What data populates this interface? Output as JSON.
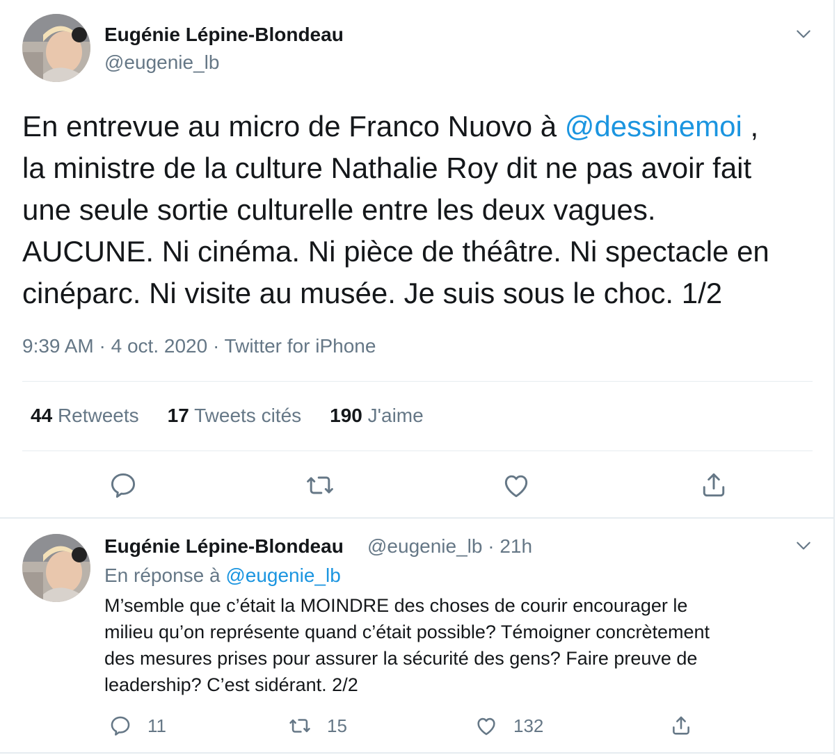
{
  "tweet": {
    "author_name": "Eugénie Lépine-Blondeau",
    "author_handle": "@eugenie_lb",
    "text_lines": [
      "En entrevue au micro de Franco Nuovo à ",
      "la ministre de la culture Nathalie Roy dit ne pas avoir fait",
      "une seule sortie culturelle entre les deux vagues.",
      "AUCUNE. Ni cinéma. Ni pièce de théâtre. Ni spectacle en",
      "cinéparc. Ni visite au musée. Je suis sous le choc. 1/2"
    ],
    "mention": "@dessinemoi",
    "mention_suffix": " ,",
    "meta": "9:39 AM · 4 oct. 2020 · Twitter for iPhone",
    "stats": {
      "retweets_count": "44",
      "retweets_label": "Retweets",
      "quotes_count": "17",
      "quotes_label": "Tweets cités",
      "likes_count": "190",
      "likes_label": "J'aime"
    }
  },
  "reply": {
    "author_name": "Eugénie Lépine-Blondeau",
    "handle_time": "@eugenie_lb · 21h",
    "in_reply_prefix": "En réponse à ",
    "in_reply_handle": "@eugenie_lb",
    "text_lines": [
      "M’semble que c’était la MOINDRE des choses de courir encourager le",
      "milieu qu’on représente quand c’était possible? Témoigner concrètement",
      "des mesures prises pour assurer la sécurité des gens? Faire preuve de",
      "leadership? C’est sidérant. 2/2"
    ],
    "replies_count": "11",
    "retweets_count": "15",
    "likes_count": "132"
  },
  "icons": {
    "reply": "reply-icon",
    "retweet": "retweet-icon",
    "like": "heart-icon",
    "share": "share-icon",
    "menu": "chevron-down-icon"
  },
  "colors": {
    "text": "#14171a",
    "muted": "#657786",
    "link": "#1b95e0",
    "divider": "#e6ecf0"
  }
}
